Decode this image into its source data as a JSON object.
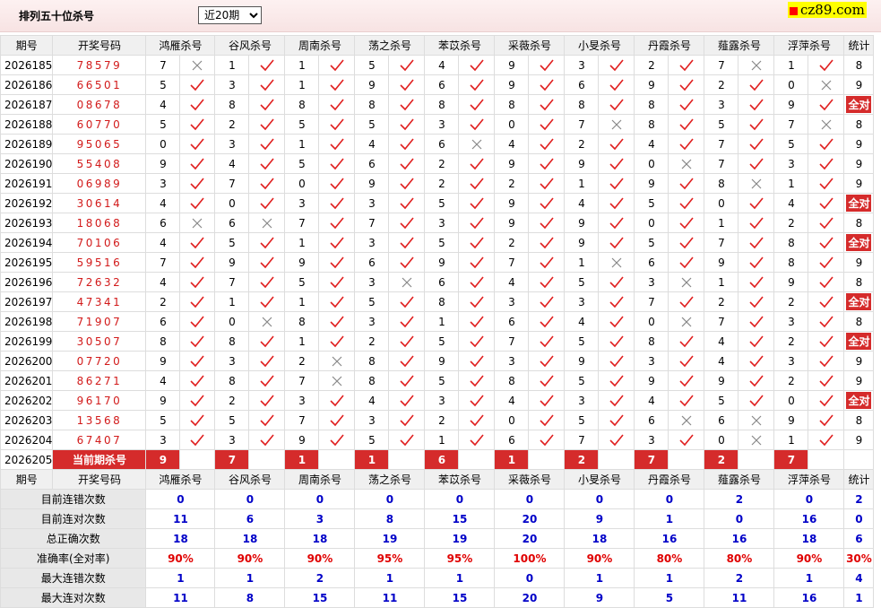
{
  "header": {
    "title": "排列五十位杀号",
    "period_options": [
      "近20期"
    ],
    "period_selected": "近20期",
    "logo": "cz89.com"
  },
  "columns": {
    "period": "期号",
    "draw": "开奖号码",
    "stat": "统计",
    "experts": [
      "鸿雁杀号",
      "谷风杀号",
      "周南杀号",
      "荡之杀号",
      "苯苡杀号",
      "采薇杀号",
      "小旻杀号",
      "丹霞杀号",
      "薤露杀号",
      "浮萍杀号"
    ]
  },
  "rows": [
    {
      "period": "2026185",
      "draw": "78579",
      "kills": [
        7,
        1,
        1,
        5,
        4,
        9,
        3,
        2,
        7,
        1
      ],
      "ok": [
        0,
        1,
        1,
        1,
        1,
        1,
        1,
        1,
        0,
        1
      ],
      "stat": "8"
    },
    {
      "period": "2026186",
      "draw": "66501",
      "kills": [
        5,
        3,
        1,
        9,
        6,
        9,
        6,
        9,
        2,
        0
      ],
      "ok": [
        1,
        1,
        1,
        1,
        1,
        1,
        1,
        1,
        1,
        0
      ],
      "stat": "9"
    },
    {
      "period": "2026187",
      "draw": "08678",
      "kills": [
        4,
        8,
        8,
        8,
        8,
        8,
        8,
        8,
        3,
        9
      ],
      "ok": [
        1,
        1,
        1,
        1,
        1,
        1,
        1,
        1,
        1,
        1
      ],
      "stat": "全对"
    },
    {
      "period": "2026188",
      "draw": "60770",
      "kills": [
        5,
        2,
        5,
        5,
        3,
        0,
        7,
        8,
        5,
        7
      ],
      "ok": [
        1,
        1,
        1,
        1,
        1,
        1,
        0,
        1,
        1,
        0
      ],
      "stat": "8"
    },
    {
      "period": "2026189",
      "draw": "95065",
      "kills": [
        0,
        3,
        1,
        4,
        6,
        4,
        2,
        4,
        7,
        5
      ],
      "ok": [
        1,
        1,
        1,
        1,
        0,
        1,
        1,
        1,
        1,
        1
      ],
      "stat": "9"
    },
    {
      "period": "2026190",
      "draw": "55408",
      "kills": [
        9,
        4,
        5,
        6,
        2,
        9,
        9,
        0,
        7,
        3
      ],
      "ok": [
        1,
        1,
        1,
        1,
        1,
        1,
        1,
        0,
        1,
        1
      ],
      "stat": "9"
    },
    {
      "period": "2026191",
      "draw": "06989",
      "kills": [
        3,
        7,
        0,
        9,
        2,
        2,
        1,
        9,
        8,
        1
      ],
      "ok": [
        1,
        1,
        1,
        1,
        1,
        1,
        1,
        1,
        0,
        1
      ],
      "stat": "9"
    },
    {
      "period": "2026192",
      "draw": "30614",
      "kills": [
        4,
        0,
        3,
        3,
        5,
        9,
        4,
        5,
        0,
        4
      ],
      "ok": [
        1,
        1,
        1,
        1,
        1,
        1,
        1,
        1,
        1,
        1
      ],
      "stat": "全对"
    },
    {
      "period": "2026193",
      "draw": "18068",
      "kills": [
        6,
        6,
        7,
        7,
        3,
        9,
        9,
        0,
        1,
        2
      ],
      "ok": [
        0,
        0,
        1,
        1,
        1,
        1,
        1,
        1,
        1,
        1
      ],
      "stat": "8"
    },
    {
      "period": "2026194",
      "draw": "70106",
      "kills": [
        4,
        5,
        1,
        3,
        5,
        2,
        9,
        5,
        7,
        8
      ],
      "ok": [
        1,
        1,
        1,
        1,
        1,
        1,
        1,
        1,
        1,
        1
      ],
      "stat": "全对"
    },
    {
      "period": "2026195",
      "draw": "59516",
      "kills": [
        7,
        9,
        9,
        6,
        9,
        7,
        1,
        6,
        9,
        8
      ],
      "ok": [
        1,
        1,
        1,
        1,
        1,
        1,
        0,
        1,
        1,
        1
      ],
      "stat": "9"
    },
    {
      "period": "2026196",
      "draw": "72632",
      "kills": [
        4,
        7,
        5,
        3,
        6,
        4,
        5,
        3,
        1,
        9
      ],
      "ok": [
        1,
        1,
        1,
        0,
        1,
        1,
        1,
        0,
        1,
        1
      ],
      "stat": "8"
    },
    {
      "period": "2026197",
      "draw": "47341",
      "kills": [
        2,
        1,
        1,
        5,
        8,
        3,
        3,
        7,
        2,
        2
      ],
      "ok": [
        1,
        1,
        1,
        1,
        1,
        1,
        1,
        1,
        1,
        1
      ],
      "stat": "全对"
    },
    {
      "period": "2026198",
      "draw": "71907",
      "kills": [
        6,
        0,
        8,
        3,
        1,
        6,
        4,
        0,
        7,
        3
      ],
      "ok": [
        1,
        0,
        1,
        1,
        1,
        1,
        1,
        0,
        1,
        1
      ],
      "stat": "8"
    },
    {
      "period": "2026199",
      "draw": "30507",
      "kills": [
        8,
        8,
        1,
        2,
        5,
        7,
        5,
        8,
        4,
        2
      ],
      "ok": [
        1,
        1,
        1,
        1,
        1,
        1,
        1,
        1,
        1,
        1
      ],
      "stat": "全对"
    },
    {
      "period": "2026200",
      "draw": "07720",
      "kills": [
        9,
        3,
        2,
        8,
        9,
        3,
        9,
        3,
        4,
        3
      ],
      "ok": [
        1,
        1,
        0,
        1,
        1,
        1,
        1,
        1,
        1,
        1
      ],
      "stat": "9"
    },
    {
      "period": "2026201",
      "draw": "86271",
      "kills": [
        4,
        8,
        7,
        8,
        5,
        8,
        5,
        9,
        9,
        2
      ],
      "ok": [
        1,
        1,
        0,
        1,
        1,
        1,
        1,
        1,
        1,
        1
      ],
      "stat": "9"
    },
    {
      "period": "2026202",
      "draw": "96170",
      "kills": [
        9,
        2,
        3,
        4,
        3,
        4,
        3,
        4,
        5,
        0
      ],
      "ok": [
        1,
        1,
        1,
        1,
        1,
        1,
        1,
        1,
        1,
        1
      ],
      "stat": "全对"
    },
    {
      "period": "2026203",
      "draw": "13568",
      "kills": [
        5,
        5,
        7,
        3,
        2,
        0,
        5,
        6,
        6,
        9
      ],
      "ok": [
        1,
        1,
        1,
        1,
        1,
        1,
        1,
        0,
        0,
        1
      ],
      "stat": "8"
    },
    {
      "period": "2026204",
      "draw": "67407",
      "kills": [
        3,
        3,
        9,
        5,
        1,
        6,
        7,
        3,
        0,
        1
      ],
      "ok": [
        1,
        1,
        1,
        1,
        1,
        1,
        1,
        1,
        0,
        1
      ],
      "stat": "9"
    }
  ],
  "current": {
    "period": "2026205",
    "label": "当前期杀号",
    "kills": [
      9,
      7,
      1,
      1,
      6,
      1,
      2,
      7,
      2,
      7
    ]
  },
  "summary": [
    {
      "label": "目前连错次数",
      "values": [
        "0",
        "0",
        "0",
        "0",
        "0",
        "0",
        "0",
        "0",
        "2",
        "0",
        "2"
      ]
    },
    {
      "label": "目前连对次数",
      "values": [
        "11",
        "6",
        "3",
        "8",
        "15",
        "20",
        "9",
        "1",
        "0",
        "16",
        "0"
      ]
    },
    {
      "label": "总正确次数",
      "values": [
        "18",
        "18",
        "18",
        "19",
        "19",
        "20",
        "18",
        "16",
        "16",
        "18",
        "6"
      ]
    },
    {
      "label": "准确率(全对率)",
      "values": [
        "90%",
        "90%",
        "90%",
        "95%",
        "95%",
        "100%",
        "90%",
        "80%",
        "80%",
        "90%",
        "30%"
      ]
    },
    {
      "label": "最大连错次数",
      "values": [
        "1",
        "1",
        "2",
        "1",
        "1",
        "0",
        "1",
        "1",
        "2",
        "1",
        "4"
      ]
    },
    {
      "label": "最大连对次数",
      "values": [
        "11",
        "8",
        "15",
        "11",
        "15",
        "20",
        "9",
        "5",
        "11",
        "16",
        "1"
      ]
    }
  ],
  "colors": {
    "accent": "#d52b2b",
    "check": "#e02020",
    "cross": "#888888",
    "summary_value": "#0000c8",
    "summary_rate": "#e00000"
  }
}
